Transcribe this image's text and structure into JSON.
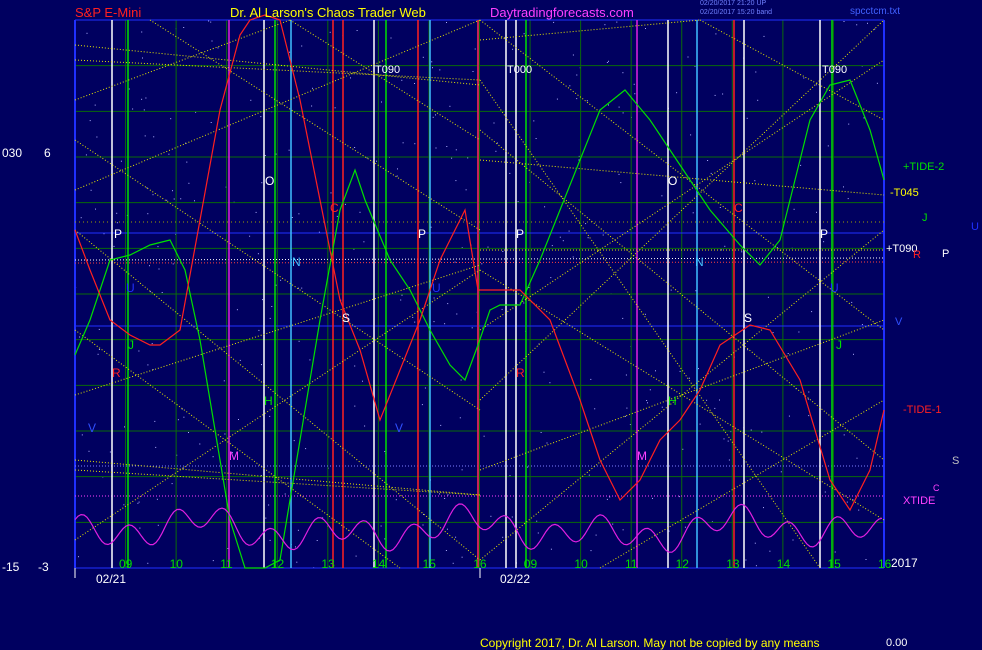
{
  "header": {
    "symbol": "S&P E-Mini",
    "site": "Dr. Al Larson's Chaos Trader Web",
    "url": "Daytradingforecasts.com",
    "stamp1": "02/20/2017 21:20 UP",
    "stamp2": "02/20/2017 15:20 band",
    "file": "spcctcm.txt"
  },
  "left_axis": {
    "top_a": "030",
    "top_b": "6",
    "bottom_a": "-15",
    "bottom_b": "-3"
  },
  "colors": {
    "background": "#000060",
    "grid_green": "#0a6a0a",
    "grid_blue": "#2030ff",
    "tide_green": "#00e000",
    "tide_red": "#ff2020",
    "xtide": "#e020e0",
    "yellow": "#e8e800"
  },
  "chart_data": {
    "type": "line",
    "title": "S&P E-Mini",
    "x_ticks": [
      "09",
      "10",
      "11",
      "12",
      "13",
      "14",
      "15",
      "16",
      "09",
      "10",
      "11",
      "12",
      "13",
      "14",
      "15",
      "16"
    ],
    "dates": [
      "02/21",
      "02/22"
    ],
    "year": "2017",
    "series": [
      {
        "name": "+TIDE-2",
        "color": "#00e000"
      },
      {
        "name": "-TIDE-1",
        "color": "#ff2020"
      },
      {
        "name": "XTIDE",
        "color": "#e020e0"
      }
    ],
    "line_labels": [
      "-T045",
      "+T090"
    ],
    "top_labels": [
      "T090",
      "T000",
      "T090"
    ],
    "letter_markers": [
      "P",
      "O",
      "N",
      "S",
      "H",
      "M",
      "R",
      "J",
      "V",
      "C",
      "U"
    ],
    "right_letters": [
      "J",
      "U",
      "R",
      "P",
      "V",
      "S",
      "C"
    ]
  },
  "footer": {
    "copyright": "Copyright 2017, Dr. Al Larson. May not be copied by any means",
    "value": "0.00"
  }
}
